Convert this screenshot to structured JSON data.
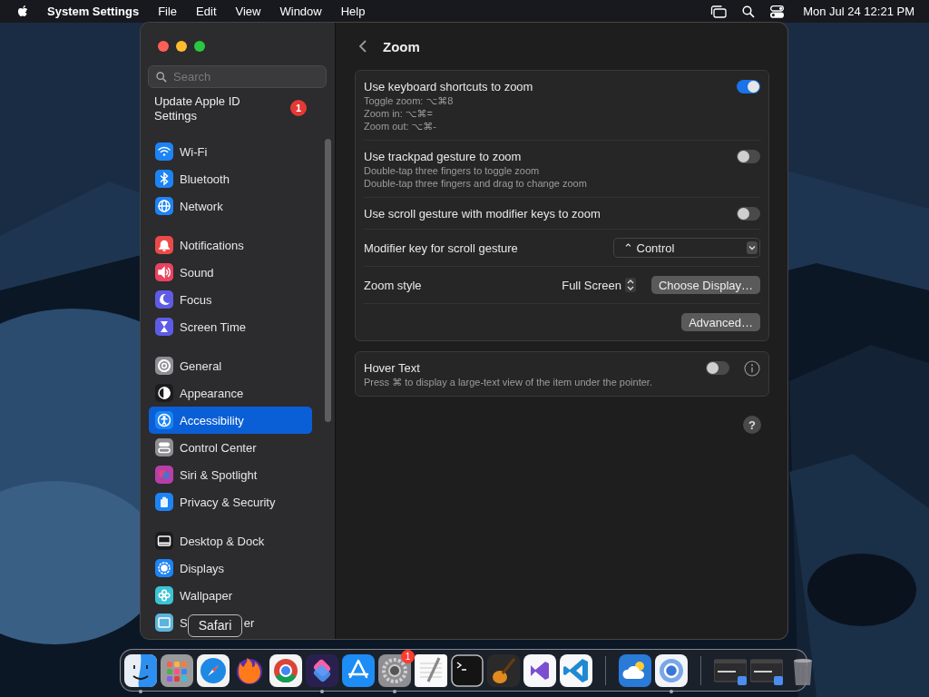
{
  "menu_bar": {
    "app_name": "System Settings",
    "menus": [
      "File",
      "Edit",
      "View",
      "Window",
      "Help"
    ],
    "clock": "Mon Jul 24  12:21 PM"
  },
  "sidebar": {
    "search": {
      "placeholder": "Search"
    },
    "account": {
      "label": "Update Apple ID Settings",
      "badge": "1"
    },
    "groups": [
      {
        "items": [
          {
            "label": "Wi-Fi",
            "color": "#1c84f5",
            "selected": false
          },
          {
            "label": "Bluetooth",
            "color": "#1c84f5",
            "selected": false
          },
          {
            "label": "Network",
            "color": "#1c84f5",
            "selected": false
          }
        ]
      },
      {
        "items": [
          {
            "label": "Notifications",
            "color": "#ec4a4a",
            "selected": false
          },
          {
            "label": "Sound",
            "color": "#e8435f",
            "selected": false
          },
          {
            "label": "Focus",
            "color": "#5e5ce6",
            "selected": false
          },
          {
            "label": "Screen Time",
            "color": "#5e5ce6",
            "selected": false
          }
        ]
      },
      {
        "items": [
          {
            "label": "General",
            "color": "#8e8e93",
            "selected": false
          },
          {
            "label": "Appearance",
            "color": "#1c1c1e",
            "selected": false
          },
          {
            "label": "Accessibility",
            "color": "#1c84f5",
            "selected": true
          },
          {
            "label": "Control Center",
            "color": "#8e8e93",
            "selected": false
          },
          {
            "label": "Siri & Spotlight",
            "color": "#b83fa8",
            "selected": false
          },
          {
            "label": "Privacy & Security",
            "color": "#1c84f5",
            "selected": false
          }
        ]
      },
      {
        "items": [
          {
            "label": "Desktop & Dock",
            "color": "#1c1c1e",
            "selected": false
          },
          {
            "label": "Displays",
            "color": "#1c84f5",
            "selected": false
          },
          {
            "label": "Wallpaper",
            "color": "#3cc3d6",
            "selected": false
          },
          {
            "label_parts": [
              "S",
              "er"
            ],
            "color": "#5ab4dc",
            "selected": false
          }
        ]
      }
    ]
  },
  "pane": {
    "title": "Zoom",
    "cards": [
      {
        "rows": [
          {
            "kind": "toggle",
            "title": "Use keyboard shortcuts to zoom",
            "details": [
              "Toggle zoom: ⌥⌘8",
              "Zoom in: ⌥⌘=",
              "Zoom out: ⌥⌘-"
            ],
            "on": true
          },
          {
            "kind": "toggle",
            "title": "Use trackpad gesture to zoom",
            "details": [
              "Double-tap three fingers to toggle zoom",
              "Double-tap three fingers and drag to change zoom"
            ],
            "on": false
          },
          {
            "kind": "toggle",
            "title": "Use scroll gesture with modifier keys to zoom",
            "on": false
          },
          {
            "kind": "dropdown",
            "title": "Modifier key for scroll gesture",
            "value": "⌃ Control"
          },
          {
            "kind": "stepper",
            "title": "Zoom style",
            "value": "Full Screen",
            "button": "Choose Display…"
          },
          {
            "kind": "button",
            "button": "Advanced…"
          }
        ]
      },
      {
        "rows": [
          {
            "kind": "toggle",
            "title": "Hover Text",
            "details": [
              "Press ⌘ to display a large-text view of the item under the pointer."
            ],
            "on": false,
            "info": true
          }
        ]
      }
    ],
    "help": "?"
  },
  "dock": {
    "groups": [
      [
        {
          "running": true
        },
        {
          "running": false
        },
        {
          "running": false,
          "tooltip": "Safari"
        },
        {
          "running": false
        },
        {
          "running": false
        },
        {
          "running": true
        },
        {
          "running": false
        },
        {
          "running": true,
          "badge": "1"
        },
        {
          "running": false
        },
        {
          "running": false
        },
        {
          "running": false
        },
        {
          "running": false
        },
        {
          "running": false
        }
      ],
      [
        {
          "running": false
        },
        {
          "running": true
        }
      ],
      [
        {
          "running": false
        },
        {
          "running": false
        },
        {
          "running": false
        }
      ]
    ]
  }
}
